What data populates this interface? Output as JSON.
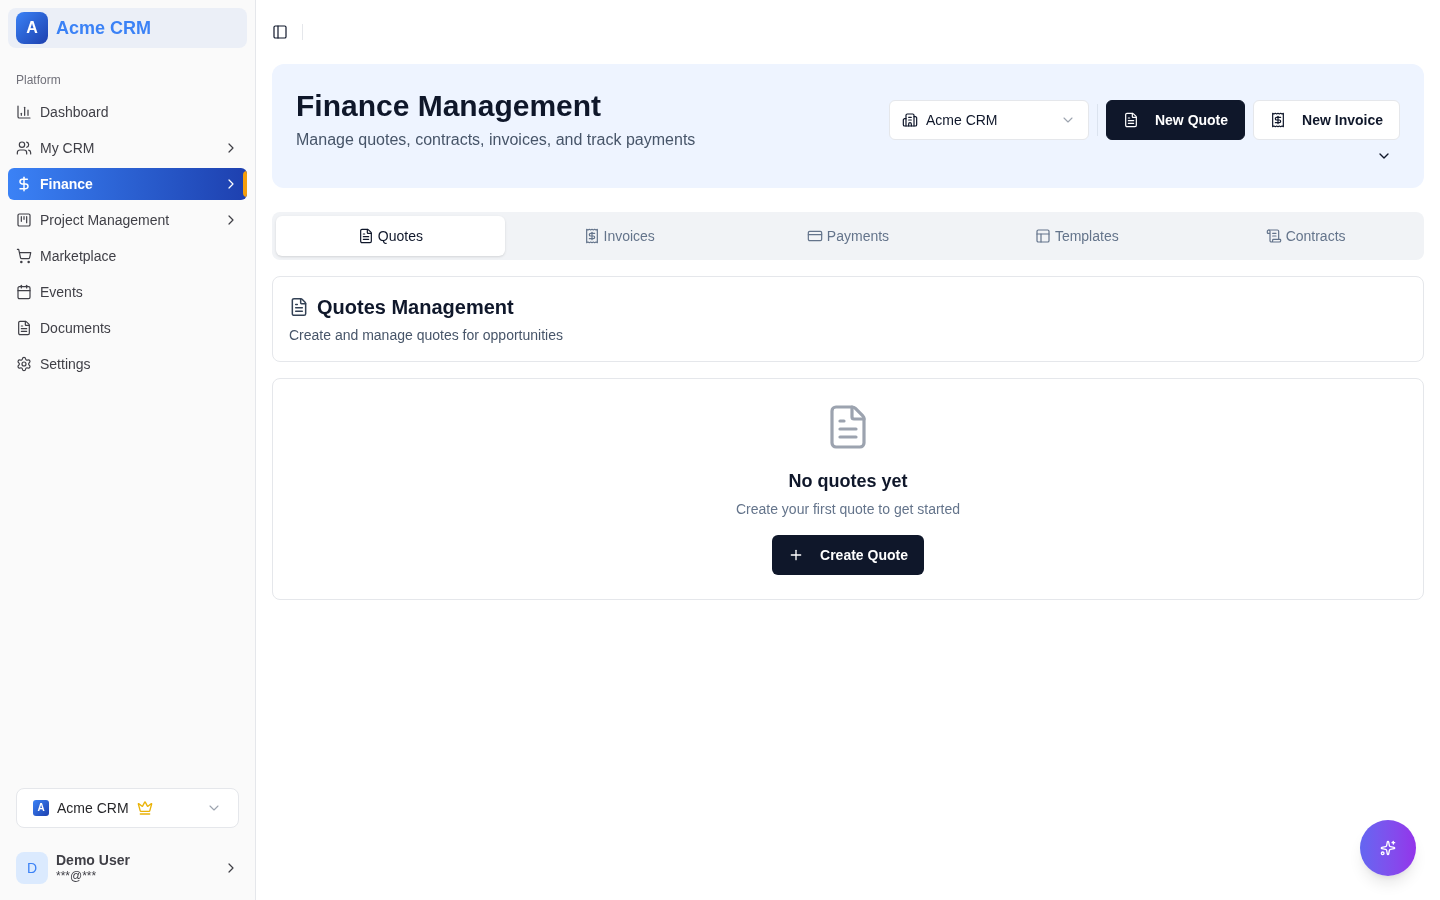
{
  "sidebar": {
    "brand": {
      "initial": "A",
      "name": "Acme CRM"
    },
    "section_label": "Platform",
    "items": [
      {
        "label": "Dashboard",
        "selected": false,
        "has_submenu": false
      },
      {
        "label": "My CRM",
        "selected": false,
        "has_submenu": true
      },
      {
        "label": "Finance",
        "selected": true,
        "has_submenu": true
      },
      {
        "label": "Project Management",
        "selected": false,
        "has_submenu": true
      },
      {
        "label": "Marketplace",
        "selected": false,
        "has_submenu": false
      },
      {
        "label": "Events",
        "selected": false,
        "has_submenu": false
      },
      {
        "label": "Documents",
        "selected": false,
        "has_submenu": false
      },
      {
        "label": "Settings",
        "selected": false,
        "has_submenu": false
      }
    ],
    "org_switcher": {
      "initial": "A",
      "name": "Acme CRM",
      "premium": true
    },
    "user": {
      "initial": "D",
      "name": "Demo User",
      "email": "***@***"
    }
  },
  "header": {
    "title": "Finance Management",
    "subtitle": "Manage quotes, contracts, invoices, and track payments",
    "org_select": {
      "value": "Acme CRM"
    },
    "buttons": [
      {
        "label": "New Quote",
        "kind": "primary"
      },
      {
        "label": "New Invoice",
        "kind": "secondary"
      }
    ]
  },
  "tabs": [
    {
      "label": "Quotes",
      "selected": true
    },
    {
      "label": "Invoices",
      "selected": false
    },
    {
      "label": "Payments",
      "selected": false
    },
    {
      "label": "Templates",
      "selected": false
    },
    {
      "label": "Contracts",
      "selected": false
    }
  ],
  "section": {
    "title": "Quotes Management",
    "description": "Create and manage quotes for opportunities"
  },
  "empty_state": {
    "title": "No quotes yet",
    "description": "Create your first quote to get started",
    "button": "Create Quote"
  }
}
